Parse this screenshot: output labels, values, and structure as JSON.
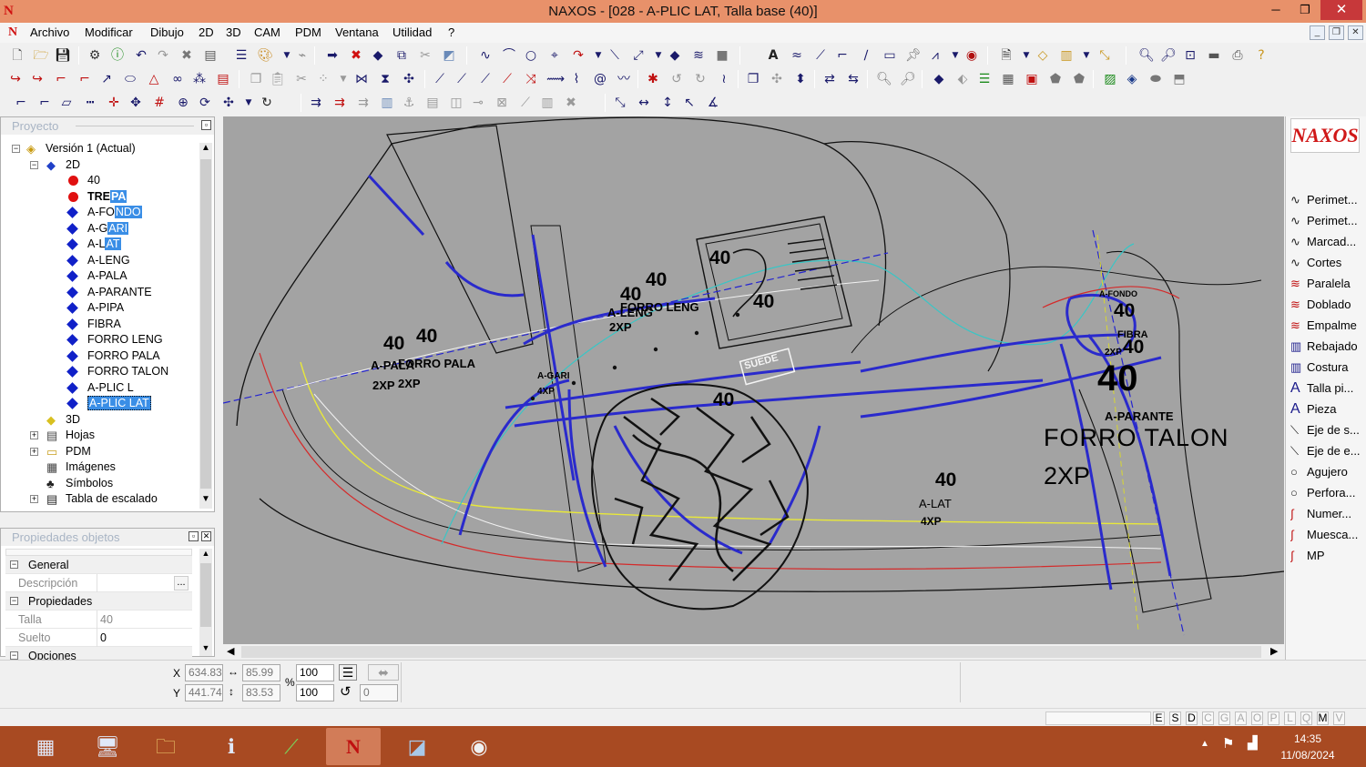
{
  "window": {
    "title": "NAXOS - [028 - A-PLIC LAT, Talla base (40)]",
    "app_icon": "N",
    "minimize_glyph": "─",
    "restore_glyph": "❐",
    "close_glyph": "✕"
  },
  "menu": {
    "items": [
      "Archivo",
      "Modificar",
      "Dibujo",
      "2D",
      "3D",
      "CAM",
      "PDM",
      "Ventana",
      "Utilidad",
      "?"
    ],
    "doc_icon": "N"
  },
  "project_panel": {
    "title": "Proyecto",
    "tree": [
      {
        "label": "Versión 1 (Actual)",
        "icon": "version-icon",
        "level": 0,
        "expander": "−"
      },
      {
        "label": "2D",
        "icon": "2d-diamond-icon",
        "level": 1,
        "expander": "−"
      },
      {
        "label": "40",
        "icon": "red-dot-icon",
        "level": 2
      },
      {
        "label_plain": "TRE",
        "label_hl": "PA",
        "icon": "red-dot-icon",
        "level": 2,
        "bold": true
      },
      {
        "label_plain": "A-FO",
        "label_hl": "NDO",
        "icon": "blue-diamond-icon",
        "level": 2
      },
      {
        "label_plain": "A-G",
        "label_hl": "ARI",
        "icon": "blue-diamond-icon",
        "level": 2
      },
      {
        "label_plain": "A-L",
        "label_hl": "AT",
        "icon": "blue-diamond-icon",
        "level": 2
      },
      {
        "label": "A-LENG",
        "icon": "blue-diamond-icon",
        "level": 2
      },
      {
        "label": "A-PALA",
        "icon": "blue-diamond-icon",
        "level": 2
      },
      {
        "label": "A-PARANTE",
        "icon": "blue-diamond-icon",
        "level": 2
      },
      {
        "label": "A-PIPA",
        "icon": "blue-diamond-icon",
        "level": 2
      },
      {
        "label": "FIBRA",
        "icon": "blue-diamond-icon",
        "level": 2
      },
      {
        "label": "FORRO LENG",
        "icon": "blue-diamond-icon",
        "level": 2
      },
      {
        "label": "FORRO PALA",
        "icon": "blue-diamond-icon",
        "level": 2
      },
      {
        "label": "FORRO TALON",
        "icon": "blue-diamond-icon",
        "level": 2
      },
      {
        "label": "A-PLIC L",
        "icon": "blue-diamond-icon",
        "level": 2
      },
      {
        "label_hl_full": "A-PLIC LAT",
        "icon": "blue-diamond-icon",
        "level": 2
      },
      {
        "label": "3D",
        "icon": "3d-icon",
        "level": 1
      },
      {
        "label": "Hojas",
        "icon": "sheets-icon",
        "level": 1,
        "expander": "+"
      },
      {
        "label": "PDM",
        "icon": "folder-icon",
        "level": 1,
        "expander": "+"
      },
      {
        "label": "Imágenes",
        "icon": "images-icon",
        "level": 1
      },
      {
        "label": "Símbolos",
        "icon": "symbols-icon",
        "level": 1
      },
      {
        "label": "Tabla de escalado",
        "icon": "table-icon",
        "level": 1,
        "expander": "+"
      }
    ]
  },
  "properties_panel": {
    "title": "Propiedades objetos",
    "rows": [
      {
        "type": "cat",
        "label": "General",
        "exp": "−"
      },
      {
        "type": "prop",
        "key": "Descripción",
        "value": "",
        "button": "..."
      },
      {
        "type": "cat",
        "label": "Propiedades",
        "exp": "−"
      },
      {
        "type": "prop",
        "key": "Talla",
        "value": "40"
      },
      {
        "type": "prop",
        "key": "Suelto",
        "value": "0"
      },
      {
        "type": "cat",
        "label": "Opciones",
        "exp": "−"
      }
    ]
  },
  "canvas_labels": {
    "t40_a": "40",
    "t40_b": "40",
    "t40_c": "40",
    "t40_d": "40",
    "t40_e": "40",
    "t40_f": "40",
    "t40_g": "40",
    "t40_h": "40",
    "t40_i": "40",
    "t40_j": "40",
    "t40_big": "40",
    "a_pala": "A-PALA",
    "forro_pala": "FORRO PALA",
    "xp2_a": "2XP",
    "xp2_b": "2XP",
    "a_leng": "A-LENG",
    "forro_leng": "FORRO LENG",
    "xp2_c": "2XP",
    "a_gari": "A-GARI",
    "xp4_a": "4XP",
    "a_fondo": "A-FONDO",
    "xp2_d": "2XP",
    "fibra": "FIBRA",
    "a_parante": "A-PARANTE",
    "forro_talon": "FORRO TALON",
    "xp2_big": "2XP",
    "a_lat": "A-LAT",
    "xp4_b": "4XP",
    "suede": "SUEDE"
  },
  "palette": {
    "logo": "NAXOS",
    "items": [
      {
        "label": "Perimet...",
        "icon": "curve-icon"
      },
      {
        "label": "Perimet...",
        "icon": "curve-icon"
      },
      {
        "label": "Marcad...",
        "icon": "curve-icon"
      },
      {
        "label": "Cortes",
        "icon": "curve-icon"
      },
      {
        "label": "Paralela",
        "icon": "parallel-icon"
      },
      {
        "label": "Doblado",
        "icon": "fold-icon"
      },
      {
        "label": "Empalme",
        "icon": "join-icon"
      },
      {
        "label": "Rebajado",
        "icon": "skive-icon"
      },
      {
        "label": "Costura",
        "icon": "stitch-icon"
      },
      {
        "label": "Talla pi...",
        "icon": "text-a-icon"
      },
      {
        "label": "Pieza",
        "icon": "text-a-icon"
      },
      {
        "label": "Eje de s...",
        "icon": "axis-icon"
      },
      {
        "label": "Eje de e...",
        "icon": "axis-icon"
      },
      {
        "label": "Agujero",
        "icon": "circle-icon"
      },
      {
        "label": "Perfora...",
        "icon": "circle-icon"
      },
      {
        "label": "Numer...",
        "icon": "number-icon"
      },
      {
        "label": "Muesca...",
        "icon": "notch-icon"
      },
      {
        "label": "MP",
        "icon": "mp-icon"
      }
    ]
  },
  "coords": {
    "x_label": "X",
    "y_label": "Y",
    "x": "634.83",
    "y": "441.74",
    "w": "85.99",
    "h": "83.53",
    "pct_symbol": "%",
    "scale_x": "100",
    "scale_y": "100",
    "rotation": "0"
  },
  "snaps": [
    "E",
    "S",
    "D",
    "C",
    "G",
    "A",
    "O",
    "P",
    "L",
    "Q",
    "M",
    "V"
  ],
  "snaps_on": [
    "E",
    "S",
    "D",
    "M"
  ],
  "taskbar": {
    "time": "14:35",
    "date": "11/08/2024",
    "apps": [
      "calculator-icon",
      "explorer-icon",
      "folder-icon",
      "info-icon",
      "design-icon",
      "naxos-icon",
      "edit-icon",
      "chrome-icon"
    ]
  },
  "colors": {
    "titlebar": "#e8916a",
    "canvas": "#a3a3a3",
    "taskbar": "#a84a22",
    "highlight": "#3a8ee6"
  }
}
